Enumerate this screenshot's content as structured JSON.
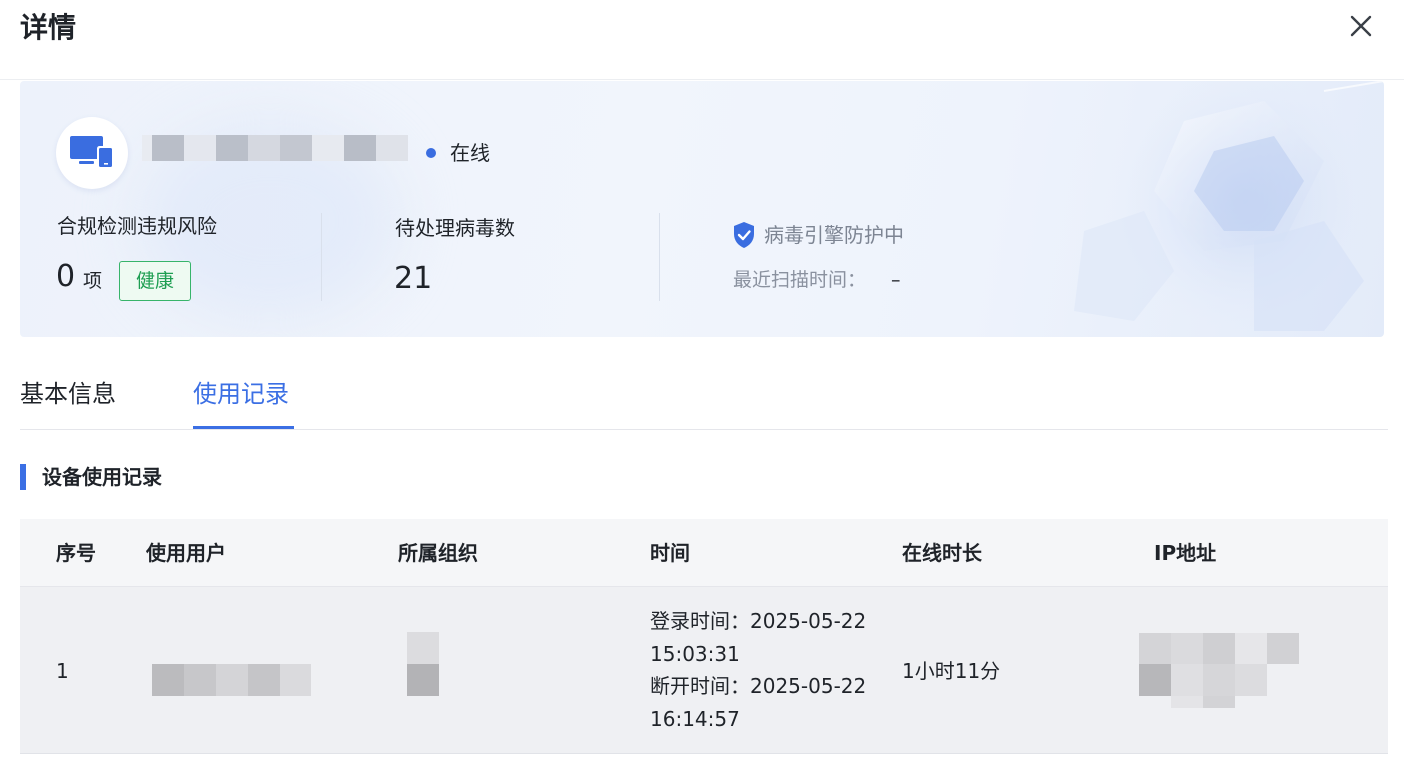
{
  "header": {
    "title": "详情"
  },
  "device": {
    "status": "在线"
  },
  "stats": {
    "compliance": {
      "label": "合规检测违规风险",
      "value": "0",
      "unit": "项",
      "badge": "健康"
    },
    "virus": {
      "label": "待处理病毒数",
      "value": "21"
    },
    "engine": {
      "status": "病毒引擎防护中",
      "scan_label": "最近扫描时间：",
      "scan_value": "–"
    }
  },
  "colors": {
    "accent": "#3b6fe4",
    "healthy": "#1e9e52",
    "online": "#3a6de0"
  },
  "tabs": [
    {
      "label": "基本信息",
      "active": false
    },
    {
      "label": "使用记录",
      "active": true
    }
  ],
  "section": {
    "title": "设备使用记录"
  },
  "table": {
    "columns": [
      "序号",
      "使用用户",
      "所属组织",
      "时间",
      "在线时长",
      "IP地址"
    ],
    "rows": [
      {
        "index": "1",
        "login": "登录时间：2025-05-22 15:03:31",
        "logout": "断开时间：2025-05-22 16:14:57",
        "duration": "1小时11分"
      }
    ]
  }
}
